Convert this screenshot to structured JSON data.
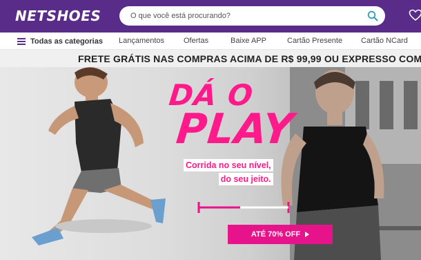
{
  "header": {
    "logo_text": "NETSHOES",
    "search_placeholder": "O que você está procurando?",
    "brand_color": "#5a2c8a",
    "icons": [
      "search-icon",
      "heart-icon"
    ]
  },
  "nav": {
    "categories_label": "Todas as categorias",
    "items": [
      "Lançamentos",
      "Ofertas",
      "Baixe APP",
      "Cartão Presente",
      "Cartão NCard"
    ]
  },
  "strip": {
    "part1": "FRETE GRÁTIS",
    "part2": " NAS COMPRAS ACIMA DE R$ 99,99 OU ",
    "part3": "EXPRESSO COM AT"
  },
  "hero": {
    "headline_line1": "DÁ O",
    "headline_line2": "PLAY",
    "sub_line1": "Corrida no seu nível,",
    "sub_line2": "do seu jeito.",
    "cta_label": "ATÉ 70% OFF",
    "accent_color": "#ff1a8c"
  }
}
